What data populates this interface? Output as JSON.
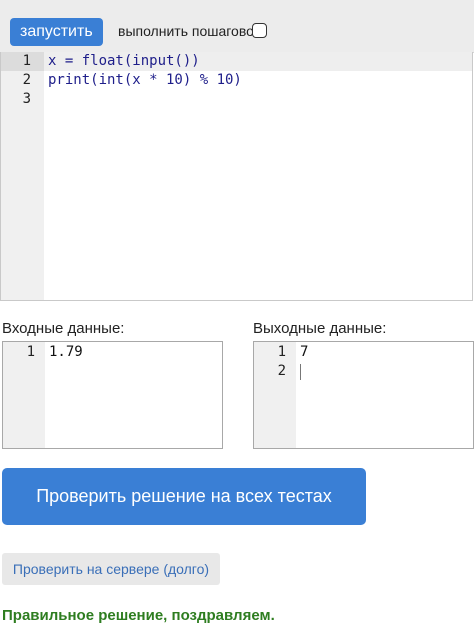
{
  "toolbar": {
    "run_label": "запустить",
    "step_label": "выполнить пошагово",
    "step_checked": false
  },
  "editor": {
    "lines": [
      {
        "number": "1",
        "text": "x = float(input())"
      },
      {
        "number": "2",
        "text": "print(int(x * 10) % 10)"
      },
      {
        "number": "3",
        "text": ""
      }
    ]
  },
  "input_panel": {
    "label": "Входные данные:",
    "lines": [
      {
        "number": "1",
        "text": "1.79"
      }
    ]
  },
  "output_panel": {
    "label": "Выходные данные:",
    "lines": [
      {
        "number": "1",
        "text": "7"
      },
      {
        "number": "2",
        "text": ""
      }
    ]
  },
  "check_all_label": "Проверить решение на всех тестах",
  "check_server_label": "Проверить на сервере (долго)",
  "status_text": "Правильное решение, поздравляем.",
  "colors": {
    "accent": "#3a7fd5",
    "success": "#2e7d20"
  }
}
